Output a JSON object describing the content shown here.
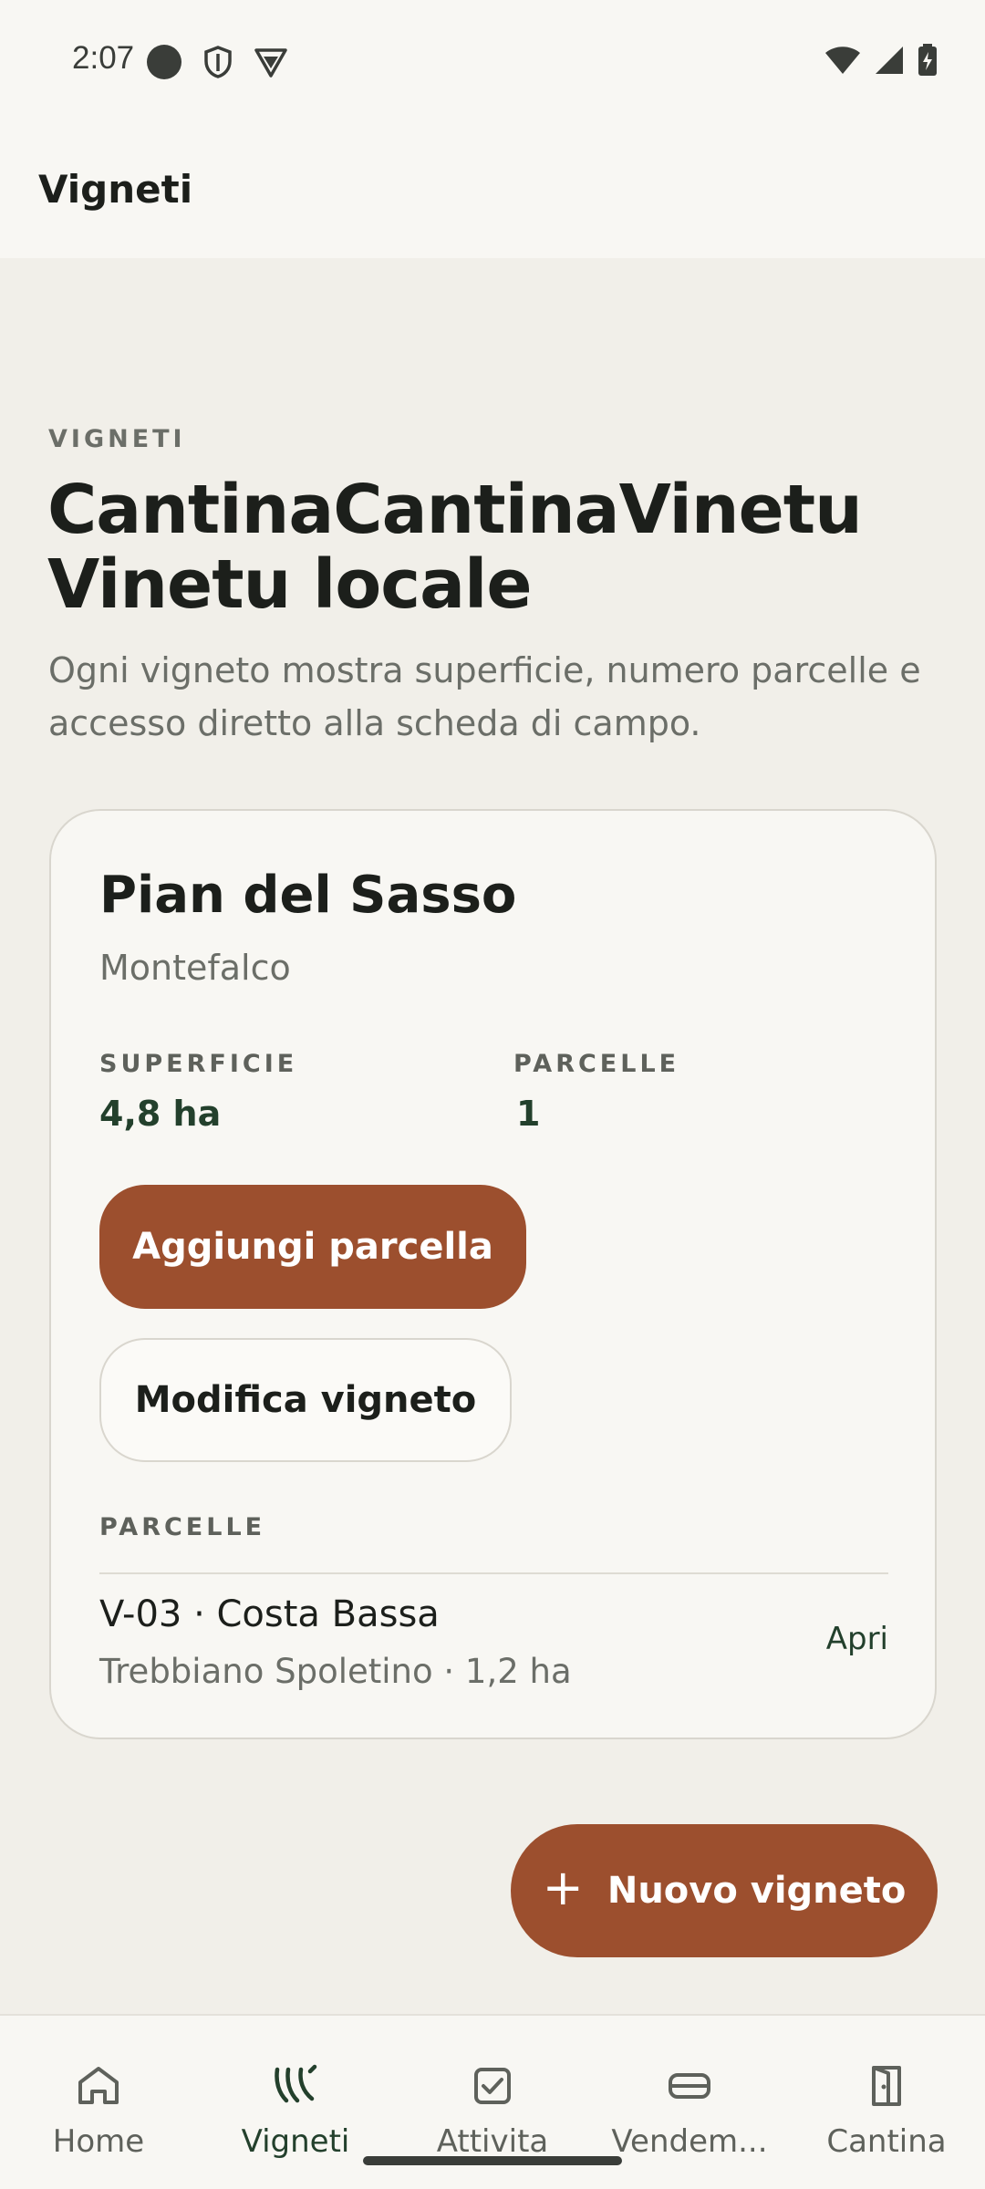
{
  "status_bar": {
    "time": "2:07"
  },
  "app_bar": {
    "title": "Vigneti"
  },
  "header": {
    "eyebrow": "VIGNETI",
    "title": "CantinaCantinaVinetu Vinetu locale",
    "description": "Ogni vigneto mostra superficie, numero parcelle e accesso diretto alla scheda di campo."
  },
  "vineyard_card": {
    "name": "Pian del Sasso",
    "location": "Montefalco",
    "area_label": "SUPERFICIE",
    "area_value": "4,8 ha",
    "parcels_label": "PARCELLE",
    "parcels_count": "1",
    "add_parcel_label": "Aggiungi parcella",
    "edit_label": "Modifica vigneto",
    "parcels_section_label": "PARCELLE",
    "parcels": [
      {
        "name": "V-03 · Costa Bassa",
        "meta": "Trebbiano Spoletino · 1,2 ha",
        "action": "Apri"
      }
    ]
  },
  "fab": {
    "label": "Nuovo vigneto",
    "icon": "plus-icon"
  },
  "bottom_nav": {
    "items": [
      {
        "label": "Home",
        "icon": "home-icon"
      },
      {
        "label": "Vigneti",
        "icon": "vines-icon",
        "active": true
      },
      {
        "label": "Attivita",
        "icon": "checkbox-icon"
      },
      {
        "label": "Vendem...",
        "icon": "harvest-crate-icon"
      },
      {
        "label": "Cantina",
        "icon": "door-icon"
      }
    ]
  },
  "colors": {
    "accent": "#9c4f2e",
    "green": "#23402c",
    "background": "#f1efe9",
    "surface": "#f8f7f3"
  }
}
